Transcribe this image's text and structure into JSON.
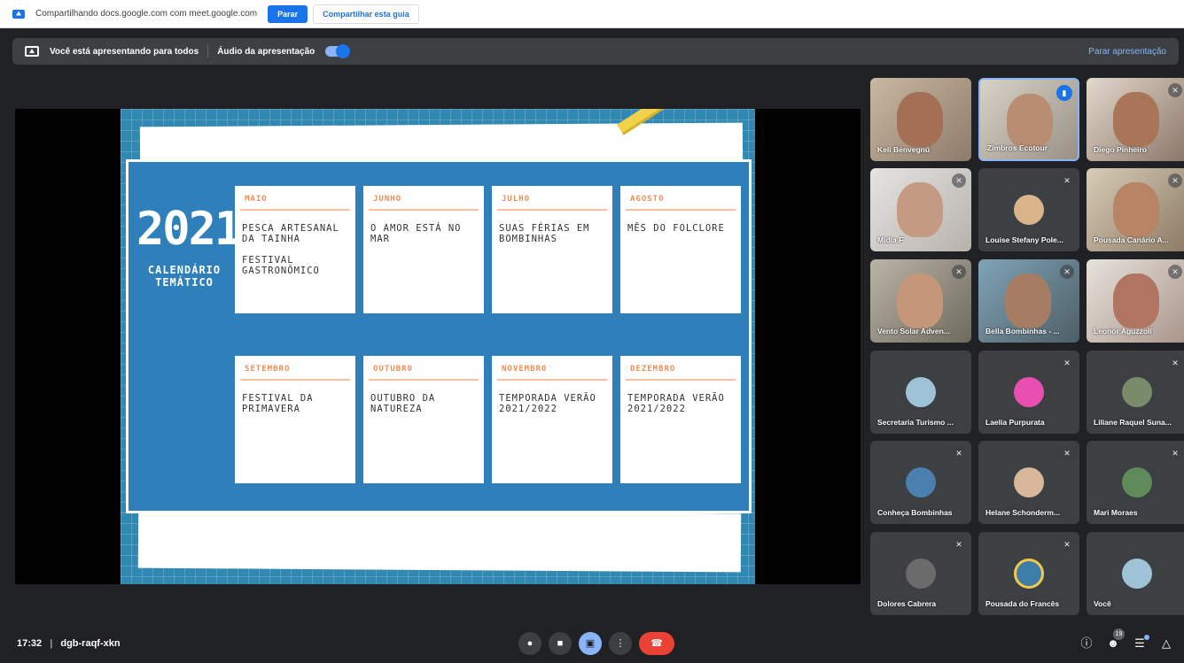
{
  "share_bar": {
    "text": "Compartilhando docs.google.com com meet.google.com",
    "stop_label": "Parar",
    "share_tab_label": "Compartilhar esta guia"
  },
  "presenting_bar": {
    "text": "Você está apresentando para todos",
    "audio_label": "Áudio da apresentação",
    "audio_on": true,
    "stop_label": "Parar apresentação"
  },
  "slide": {
    "year": "2021",
    "title": "CALENDÁRIO\nTEMÁTICO",
    "months": [
      {
        "month": "MAIO",
        "event": "PESCA ARTESANAL\nDA TAINHA\n\nFESTIVAL\nGASTRONÔMICO"
      },
      {
        "month": "JUNHO",
        "event": "O AMOR ESTÁ NO\nMAR"
      },
      {
        "month": "JULHO",
        "event": "SUAS FÉRIAS EM\nBOMBINHAS"
      },
      {
        "month": "AGOSTO",
        "event": "MÊS DO FOLCLORE"
      },
      {
        "month": "SETEMBRO",
        "event": "FESTIVAL DA\nPRIMAVERA"
      },
      {
        "month": "OUTUBRO",
        "event": "OUTUBRO DA\nNATUREZA"
      },
      {
        "month": "NOVEMBRO",
        "event": "TEMPORADA VERÃO\n2021/2022"
      },
      {
        "month": "DEZEMBRO",
        "event": "TEMPORADA VERÃO\n2021/2022"
      }
    ]
  },
  "participants": [
    {
      "name": "Keli Benvegnú",
      "muted": false,
      "speaking": false
    },
    {
      "name": "Zimbros Ecotour",
      "muted": false,
      "speaking": true
    },
    {
      "name": "Diego Pinheiro",
      "muted": true,
      "speaking": false
    },
    {
      "name": "Mídia F",
      "muted": true,
      "speaking": false
    },
    {
      "name": "Louise Stefany Pole...",
      "muted": true,
      "speaking": false
    },
    {
      "name": "Pousada Canário A...",
      "muted": true,
      "speaking": false
    },
    {
      "name": "Vento Solar Adven...",
      "muted": true,
      "speaking": false
    },
    {
      "name": "Bella Bombinhas - ...",
      "muted": true,
      "speaking": false
    },
    {
      "name": "Leonor Aguzzoli",
      "muted": true,
      "speaking": false
    },
    {
      "name": "Secretaria Turismo ...",
      "muted": false,
      "speaking": false
    },
    {
      "name": "Laelia Purpurata",
      "muted": true,
      "speaking": false
    },
    {
      "name": "Liliane Raquel Suna...",
      "muted": true,
      "speaking": false
    },
    {
      "name": "Conheça Bombinhas",
      "muted": true,
      "speaking": false
    },
    {
      "name": "Helane Schonderm...",
      "muted": true,
      "speaking": false
    },
    {
      "name": "Mari Moraes",
      "muted": true,
      "speaking": false
    },
    {
      "name": "Dolores Cabrera",
      "muted": true,
      "speaking": false
    },
    {
      "name": "Pousada do Francês",
      "muted": true,
      "speaking": false
    },
    {
      "name": "Você",
      "muted": false,
      "speaking": false
    }
  ],
  "bottom_bar": {
    "time": "17:32",
    "separator": "|",
    "meeting_code": "dgb-raqf-xkn",
    "participant_count": "19"
  },
  "icons": {
    "mic": "mic-icon",
    "camera": "camera-icon",
    "present": "present-icon",
    "more": "more-icon",
    "leave": "leave-call-icon",
    "info": "info-icon",
    "people": "people-icon",
    "chat": "chat-icon",
    "activities": "activities-icon"
  },
  "colors": {
    "accent": "#1a73e8",
    "leave": "#ea4335",
    "slide_blue": "#2f89b3",
    "month_orange": "#ef8e57"
  }
}
